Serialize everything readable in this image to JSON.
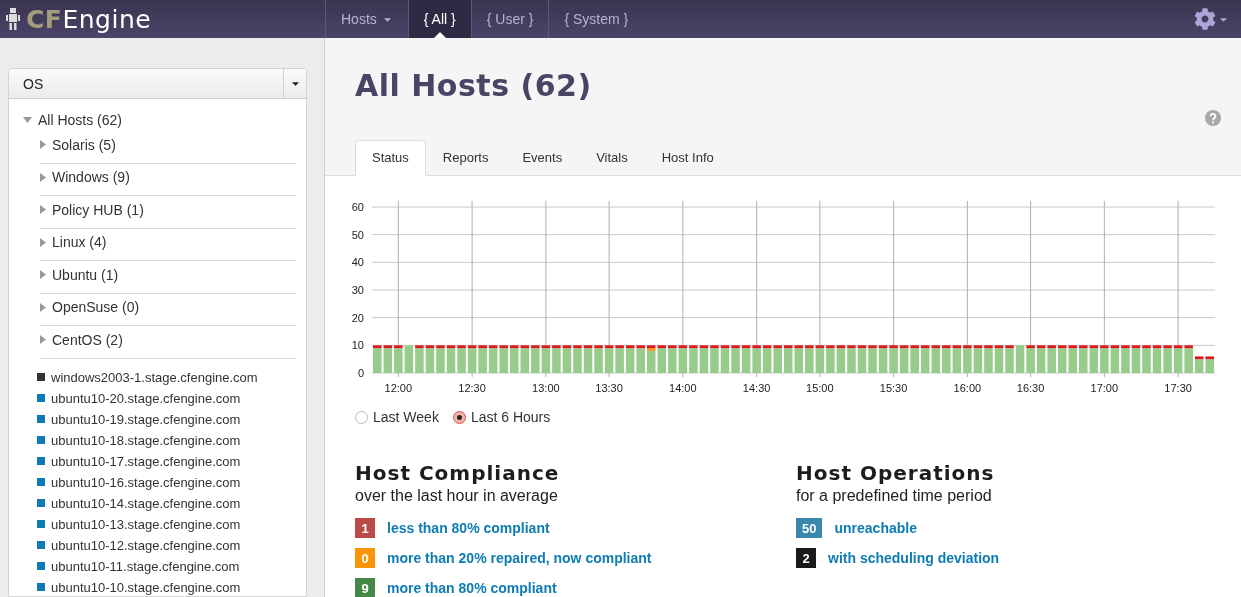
{
  "navbar": {
    "logo": {
      "brand": "CF",
      "name": "Engine"
    },
    "items": [
      {
        "label": "Hosts",
        "dropdown": true,
        "selected": false
      },
      {
        "label": "{ All }",
        "dropdown": false,
        "selected": true
      },
      {
        "label": "{ User }",
        "dropdown": false,
        "selected": false
      },
      {
        "label": "{ System }",
        "dropdown": false,
        "selected": false
      }
    ]
  },
  "sidebar": {
    "filter": {
      "value": "OS"
    },
    "tree": [
      {
        "label": "All Hosts (62)",
        "expanded": true,
        "children": [
          {
            "label": "Solaris (5)",
            "expanded": false
          },
          {
            "label": "Windows (9)",
            "expanded": false
          },
          {
            "label": "Policy HUB (1)",
            "expanded": false
          },
          {
            "label": "Linux (4)",
            "expanded": false
          },
          {
            "label": "Ubuntu (1)",
            "expanded": false
          },
          {
            "label": "OpenSuse (0)",
            "expanded": false
          },
          {
            "label": "CentOS (2)",
            "expanded": false
          }
        ]
      }
    ],
    "hosts": [
      {
        "name": "windows2003-1.stage.cfengine.com",
        "color": "#333333"
      },
      {
        "name": "ubuntu10-20.stage.cfengine.com",
        "color": "#0e7bb4"
      },
      {
        "name": "ubuntu10-19.stage.cfengine.com",
        "color": "#0e7bb4"
      },
      {
        "name": "ubuntu10-18.stage.cfengine.com",
        "color": "#0e7bb4"
      },
      {
        "name": "ubuntu10-17.stage.cfengine.com",
        "color": "#0e7bb4"
      },
      {
        "name": "ubuntu10-16.stage.cfengine.com",
        "color": "#0e7bb4"
      },
      {
        "name": "ubuntu10-14.stage.cfengine.com",
        "color": "#0e7bb4"
      },
      {
        "name": "ubuntu10-13.stage.cfengine.com",
        "color": "#0e7bb4"
      },
      {
        "name": "ubuntu10-12.stage.cfengine.com",
        "color": "#0e7bb4"
      },
      {
        "name": "ubuntu10-11.stage.cfengine.com",
        "color": "#0e7bb4"
      },
      {
        "name": "ubuntu10-10.stage.cfengine.com",
        "color": "#0e7bb4"
      }
    ]
  },
  "main": {
    "title": "All Hosts (62)",
    "tabs": [
      {
        "label": "Status",
        "selected": true
      },
      {
        "label": "Reports",
        "selected": false
      },
      {
        "label": "Events",
        "selected": false
      },
      {
        "label": "Vitals",
        "selected": false
      },
      {
        "label": "Host Info",
        "selected": false
      }
    ],
    "chart_data": {
      "type": "bar",
      "stacked": true,
      "grid": true,
      "ylim": [
        0,
        60
      ],
      "categories": [
        null,
        null,
        "12:00",
        null,
        null,
        null,
        null,
        null,
        null,
        "12:30",
        null,
        null,
        null,
        null,
        null,
        null,
        "13:00",
        null,
        null,
        null,
        null,
        null,
        "13:30",
        null,
        null,
        null,
        null,
        null,
        null,
        "14:00",
        null,
        null,
        null,
        null,
        null,
        null,
        "14:30",
        null,
        null,
        null,
        null,
        null,
        "15:00",
        null,
        null,
        null,
        null,
        null,
        null,
        "15:30",
        null,
        null,
        null,
        null,
        null,
        null,
        "16:00",
        null,
        null,
        null,
        null,
        null,
        "16:30",
        null,
        null,
        null,
        null,
        null,
        null,
        "17:00",
        null,
        null,
        null,
        null,
        null,
        null,
        "17:30",
        null,
        null,
        null
      ],
      "yticks": [
        0,
        10,
        20,
        30,
        40,
        50,
        60
      ],
      "series": [
        {
          "color": "#98cc8c",
          "values": [
            9,
            9,
            9,
            10,
            9,
            9,
            9,
            9,
            9,
            9,
            9,
            9,
            9,
            9,
            9,
            9,
            9,
            9,
            9,
            9,
            9,
            9,
            9,
            9,
            9,
            9,
            8,
            9,
            9,
            9,
            9,
            9,
            9,
            9,
            9,
            9,
            9,
            9,
            9,
            9,
            9,
            9,
            9,
            9,
            9,
            9,
            9,
            9,
            9,
            9,
            9,
            9,
            9,
            9,
            9,
            9,
            9,
            9,
            9,
            9,
            9,
            10,
            9,
            9,
            9,
            9,
            9,
            9,
            9,
            9,
            9,
            9,
            9,
            9,
            9,
            9,
            9,
            9,
            5,
            5
          ]
        },
        {
          "color": "#f7941d",
          "values": [
            0,
            0,
            0,
            0,
            0,
            0,
            0,
            0,
            0,
            0,
            0,
            0,
            0,
            0,
            0,
            0,
            0,
            0,
            0,
            0,
            0,
            0,
            0,
            0,
            0,
            0,
            1,
            0,
            0,
            0,
            0,
            0,
            0,
            0,
            0,
            0,
            0,
            0,
            0,
            0,
            0,
            0,
            0,
            0,
            0,
            0,
            0,
            0,
            0,
            0,
            0,
            0,
            0,
            0,
            0,
            0,
            0,
            0,
            0,
            0,
            0,
            0,
            0,
            0,
            0,
            0,
            0,
            0,
            0,
            0,
            0,
            0,
            0,
            0,
            0,
            0,
            0,
            0,
            0,
            0
          ]
        },
        {
          "color": "#e3141b",
          "values": [
            1,
            1,
            1,
            0,
            1,
            1,
            1,
            1,
            1,
            1,
            1,
            1,
            1,
            1,
            1,
            1,
            1,
            1,
            1,
            1,
            1,
            1,
            1,
            1,
            1,
            1,
            1,
            1,
            1,
            1,
            1,
            1,
            1,
            1,
            1,
            1,
            1,
            1,
            1,
            1,
            1,
            1,
            1,
            1,
            1,
            1,
            1,
            1,
            1,
            1,
            1,
            1,
            1,
            1,
            1,
            1,
            1,
            1,
            1,
            1,
            1,
            0,
            1,
            1,
            1,
            1,
            1,
            1,
            1,
            1,
            1,
            1,
            1,
            1,
            1,
            1,
            1,
            1,
            1,
            1
          ]
        }
      ]
    },
    "periods": [
      {
        "label": "Last Week",
        "selected": false
      },
      {
        "label": "Last 6 Hours",
        "selected": true
      }
    ],
    "sections": [
      {
        "title": "Host Compliance",
        "subtitle": "over the last hour in average",
        "items": [
          {
            "count": "1",
            "label": "less than 80% compliant",
            "color": "#b94a48"
          },
          {
            "count": "0",
            "label": "more than 20% repaired, now compliant",
            "color": "#f89406"
          },
          {
            "count": "9",
            "label": "more than 80% compliant",
            "color": "#468847"
          }
        ]
      },
      {
        "title": "Host Operations",
        "subtitle": "for a predefined time period",
        "items": [
          {
            "count": "50",
            "label": "unreachable",
            "color": "#3a87ad"
          },
          {
            "count": "2",
            "label": "with scheduling deviation",
            "color": "#1a1a1a"
          }
        ]
      }
    ]
  }
}
